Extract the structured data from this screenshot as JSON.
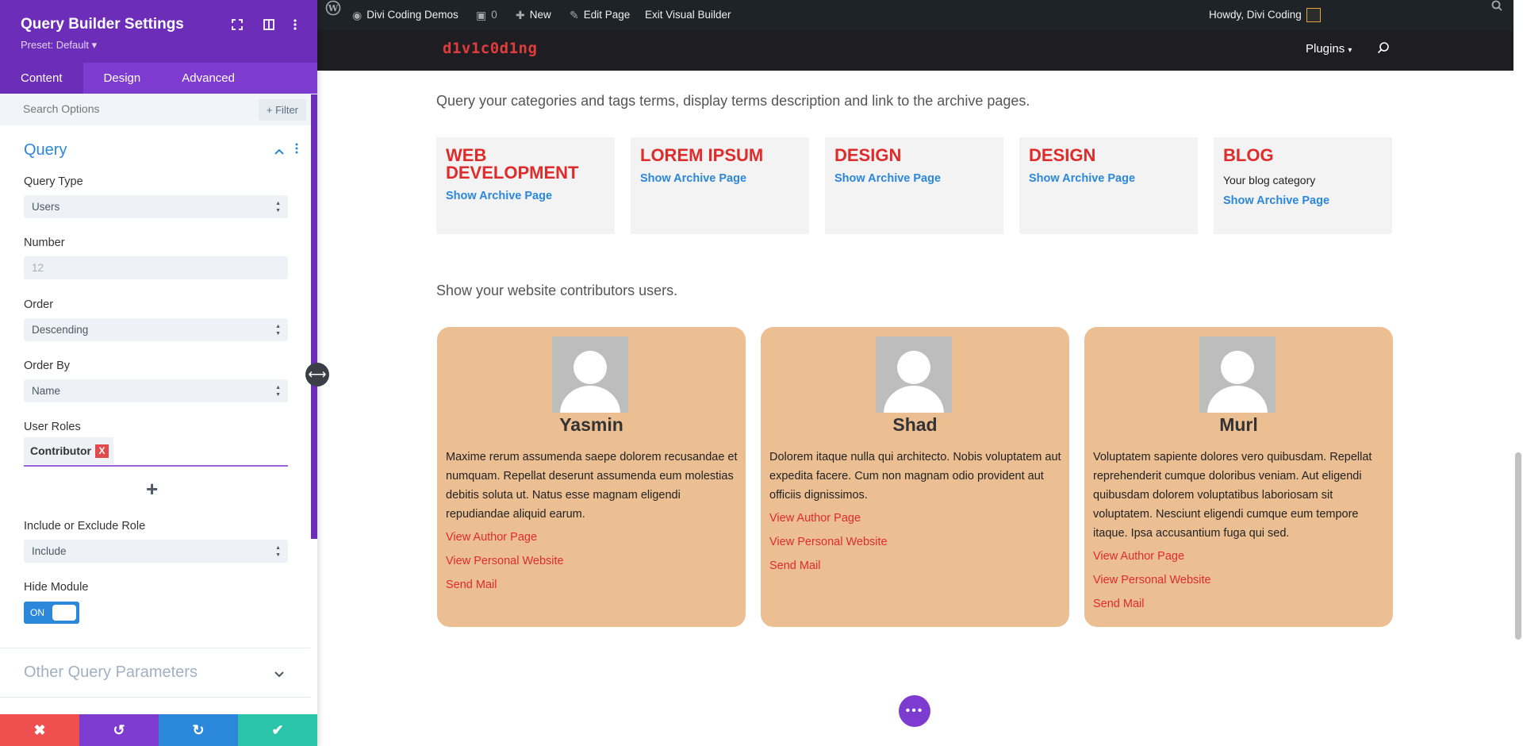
{
  "panel": {
    "title": "Query Builder Settings",
    "preset": "Preset: Default ▾",
    "tabs": [
      {
        "label": "Content",
        "active": true
      },
      {
        "label": "Design"
      },
      {
        "label": "Advanced"
      }
    ],
    "search_placeholder": "Search Options",
    "filter_label": "+ Filter",
    "section_title": "Query",
    "fields": {
      "query_type": {
        "label": "Query Type",
        "value": "Users"
      },
      "number": {
        "label": "Number",
        "value": "12"
      },
      "order": {
        "label": "Order",
        "value": "Descending"
      },
      "order_by": {
        "label": "Order By",
        "value": "Name"
      },
      "user_roles": {
        "label": "User Roles",
        "chip": "Contributor",
        "remove": "X"
      },
      "include_exclude": {
        "label": "Include or Exclude Role",
        "value": "Include"
      },
      "hide_module": {
        "label": "Hide Module",
        "toggle": "ON"
      }
    },
    "other_section": "Other Query Parameters",
    "bottom_colors": [
      "#ef4f4f",
      "#7e3bd0",
      "#2b87da",
      "#29c4a9"
    ]
  },
  "adminbar": {
    "site_name": "Divi Coding Demos",
    "comments": "0",
    "new": "New",
    "edit_page": "Edit Page",
    "exit_builder": "Exit Visual Builder",
    "howdy": "Howdy, Divi Coding"
  },
  "header": {
    "logo": "d1v1c0d1ng",
    "nav_plugins": "Plugins"
  },
  "content": {
    "terms_intro": "Query your categories and tags terms, display terms description and link to the archive pages.",
    "terms": [
      {
        "title": "WEB DEVELOPMENT",
        "desc": "",
        "link": "Show Archive Page"
      },
      {
        "title": "LOREM IPSUM",
        "desc": "",
        "link": "Show Archive Page"
      },
      {
        "title": "DESIGN",
        "desc": "",
        "link": "Show Archive Page"
      },
      {
        "title": "DESIGN",
        "desc": "",
        "link": "Show Archive Page"
      },
      {
        "title": "BLOG",
        "desc": "Your blog category",
        "link": "Show Archive Page"
      }
    ],
    "users_intro": "Show your website contributors users.",
    "users": [
      {
        "name": "Yasmin",
        "bio": "Maxime rerum assumenda saepe dolorem recusandae et numquam. Repellat deserunt assumenda eum molestias debitis soluta ut. Natus esse magnam eligendi repudiandae aliquid earum.",
        "links": [
          "View Author Page",
          "View Personal Website",
          "Send Mail"
        ]
      },
      {
        "name": "Shad",
        "bio": "Dolorem itaque nulla qui architecto. Nobis voluptatem aut expedita facere. Cum non magnam odio provident aut officiis dignissimos.",
        "links": [
          "View Author Page",
          "View Personal Website",
          "Send Mail"
        ]
      },
      {
        "name": "Murl",
        "bio": "Voluptatem sapiente dolores vero quibusdam. Repellat reprehenderit cumque doloribus veniam. Aut eligendi quibusdam dolorem voluptatibus laboriosam sit voluptatem. Nesciunt eligendi cumque eum tempore itaque. Ipsa accusantium fuga qui sed.",
        "links": [
          "View Author Page",
          "View Personal Website",
          "Send Mail"
        ]
      }
    ]
  }
}
